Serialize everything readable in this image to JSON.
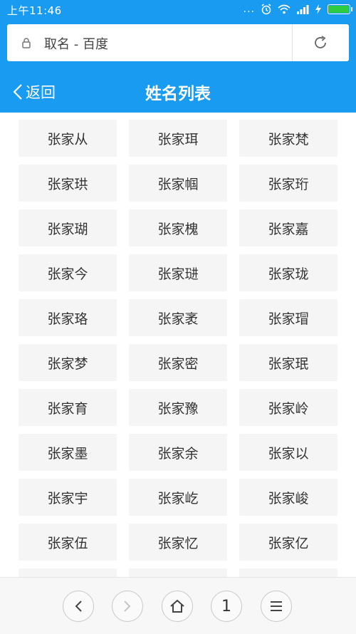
{
  "status": {
    "time": "上午11:46",
    "dots": "...",
    "battery_level": 1.0
  },
  "browser": {
    "url_text": "取名 - 百度"
  },
  "nav": {
    "back_label": "返回",
    "title": "姓名列表"
  },
  "names": [
    "张家从",
    "张家珥",
    "张家梵",
    "张家珙",
    "张家帼",
    "张家珩",
    "张家瑚",
    "张家槐",
    "张家嘉",
    "张家今",
    "张家琎",
    "张家珑",
    "张家珞",
    "张家袤",
    "张家瑁",
    "张家梦",
    "张家密",
    "张家珉",
    "张家育",
    "张家豫",
    "张家岭",
    "张家墨",
    "张家余",
    "张家以",
    "张家宇",
    "张家屹",
    "张家峻",
    "张家伍",
    "张家忆",
    "张家亿"
  ],
  "bottom_bar": {
    "tab_count": "1"
  },
  "colors": {
    "accent": "#1a9bf2",
    "cell_bg": "#f5f5f5"
  }
}
